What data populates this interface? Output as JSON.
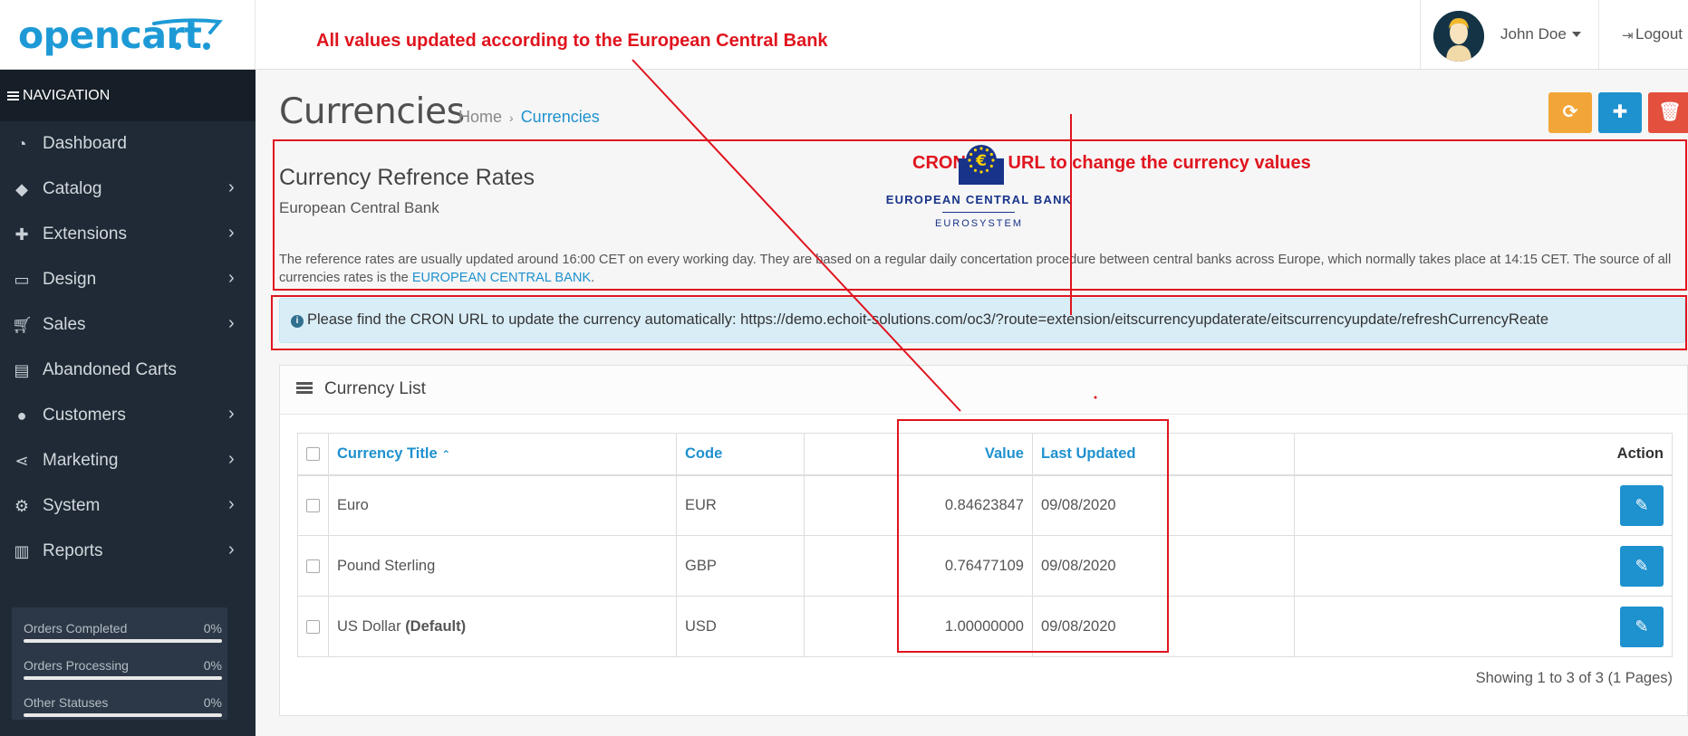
{
  "brand": {
    "logo_text": "opencart"
  },
  "annotations": {
    "top_note": "All values updated according to the European Central Bank",
    "cron_note": "CRON Job URL to change the currency values"
  },
  "user": {
    "name": "John Doe",
    "logout": "Logout"
  },
  "navigation": {
    "header": "NAVIGATION",
    "items": [
      {
        "label": "Dashboard",
        "icon": "dashboard-icon",
        "has_children": false
      },
      {
        "label": "Catalog",
        "icon": "tags-icon",
        "has_children": true
      },
      {
        "label": "Extensions",
        "icon": "puzzle-icon",
        "has_children": true
      },
      {
        "label": "Design",
        "icon": "monitor-icon",
        "has_children": true
      },
      {
        "label": "Sales",
        "icon": "cart-icon",
        "has_children": true
      },
      {
        "label": "Abandoned Carts",
        "icon": "basket-icon",
        "has_children": false
      },
      {
        "label": "Customers",
        "icon": "user-icon",
        "has_children": true
      },
      {
        "label": "Marketing",
        "icon": "share-icon",
        "has_children": true
      },
      {
        "label": "System",
        "icon": "gear-icon",
        "has_children": true
      },
      {
        "label": "Reports",
        "icon": "bar-chart-icon",
        "has_children": true
      }
    ],
    "stats": [
      {
        "label": "Orders Completed",
        "percent": "0%",
        "progress": 0
      },
      {
        "label": "Orders Processing",
        "percent": "0%",
        "progress": 0
      },
      {
        "label": "Other Statuses",
        "percent": "0%",
        "progress": 0
      }
    ]
  },
  "page": {
    "title": "Currencies",
    "breadcrumb": [
      "Home",
      "Currencies"
    ],
    "separator": "›"
  },
  "reference": {
    "title": "Currency Refrence Rates",
    "subtitle": "European Central Bank",
    "ecb_logo_line1": "EUROPEAN CENTRAL BANK",
    "ecb_logo_line2": "EUROSYSTEM",
    "text": "The reference rates are usually updated around 16:00 CET on every working day. They are based on a regular daily concertation procedure between central banks across Europe, which normally takes place at 14:15 CET. The source of all currencies rates is the ",
    "link": "EUROPEAN CENTRAL BANK",
    "text_end": "."
  },
  "alert": {
    "text": "Please find the CRON URL to update the currency automatically: https://demo.echoit-solutions.com/oc3/?route=extension/eitscurrencyupdaterate/eitscurrencyupdate/refreshCurrencyReate"
  },
  "panel": {
    "title": "Currency List",
    "columns": {
      "title": "Currency Title",
      "code": "Code",
      "value": "Value",
      "updated": "Last Updated",
      "action": "Action"
    },
    "rows": [
      {
        "title": "Euro",
        "default_tag": "",
        "code": "EUR",
        "value": "0.84623847",
        "updated": "09/08/2020"
      },
      {
        "title": "Pound Sterling",
        "default_tag": "",
        "code": "GBP",
        "value": "0.76477109",
        "updated": "09/08/2020"
      },
      {
        "title": "US Dollar ",
        "default_tag": "(Default)",
        "code": "USD",
        "value": "1.00000000",
        "updated": "09/08/2020"
      }
    ],
    "pagination": "Showing 1 to 3 of 3 (1 Pages)"
  },
  "colors": {
    "primary": "#1e91cf",
    "warning": "#f3a638",
    "danger": "#e3503e",
    "annotation": "#e0141e",
    "sidebar": "#1f2a36"
  }
}
